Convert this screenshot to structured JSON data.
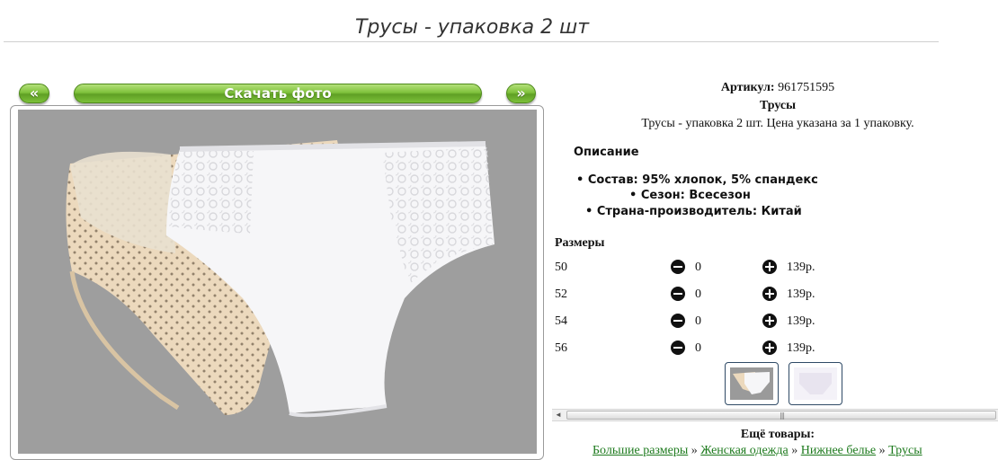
{
  "title": "Трусы - упаковка 2 шт",
  "nav": {
    "prev_label": "«",
    "download_label": "Скачать фото",
    "next_label": "»"
  },
  "product": {
    "article_label": "Артикул:",
    "article_value": "961751595",
    "name": "Трусы",
    "short_description": "Трусы - упаковка 2 шт. Цена указана за 1 упаковку.",
    "description_heading": "Описание",
    "features": [
      "Состав: 95% хлопок, 5% спандекс",
      "Сезон: Всесезон",
      "Страна-производитель: Китай"
    ]
  },
  "sizes": {
    "heading": "Размеры",
    "rows": [
      {
        "size": "50",
        "qty": "0",
        "price": "139р."
      },
      {
        "size": "52",
        "qty": "0",
        "price": "139р."
      },
      {
        "size": "54",
        "qty": "0",
        "price": "139р."
      },
      {
        "size": "56",
        "qty": "0",
        "price": "139р."
      }
    ]
  },
  "more": {
    "heading": "Ещё товары:",
    "breadcrumbs": [
      "Большие размеры",
      "Женская одежда",
      "Нижнее белье",
      "Трусы"
    ],
    "separator": " » "
  },
  "icons": {
    "minus": "minus-circle-icon",
    "plus": "plus-circle-icon"
  },
  "colors": {
    "button_green": "#7fc23c",
    "link_green": "#1d7a1d",
    "photo_bg": "#9e9e9e"
  }
}
